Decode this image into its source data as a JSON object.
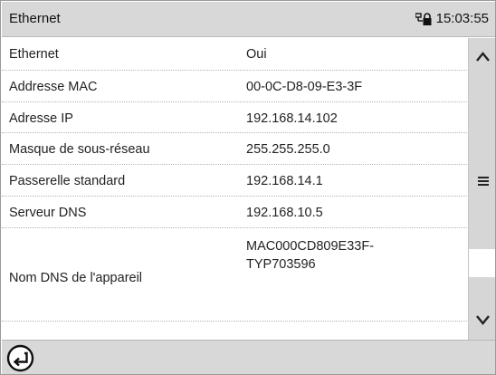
{
  "header": {
    "title": "Ethernet",
    "time": "15:03:55",
    "lock_icon": "lock-network-icon"
  },
  "rows": [
    {
      "label": "Ethernet",
      "value": "Oui"
    },
    {
      "label": "Addresse MAC",
      "value": "00-0C-D8-09-E3-3F"
    },
    {
      "label": "Adresse IP",
      "value": "192.168.14.102"
    },
    {
      "label": "Masque de sous-réseau",
      "value": "255.255.255.0"
    },
    {
      "label": "Passerelle standard",
      "value": "192.168.14.1"
    },
    {
      "label": "Serveur DNS",
      "value": "192.168.10.5"
    },
    {
      "label": "Nom DNS de l'appareil",
      "value_line1": "MAC000CD809E33F-",
      "value_line2": "TYP703596"
    }
  ],
  "scrollbar": {
    "up_icon": "chevron-up-icon",
    "menu_icon": "hamburger-menu-icon",
    "down_icon": "chevron-down-icon"
  },
  "footer": {
    "back_icon": "back-arrow-icon"
  },
  "colors": {
    "bar_gray": "#d8d8d8",
    "scroll_gray": "#d6d6d6",
    "divider": "#b5b5b5"
  }
}
